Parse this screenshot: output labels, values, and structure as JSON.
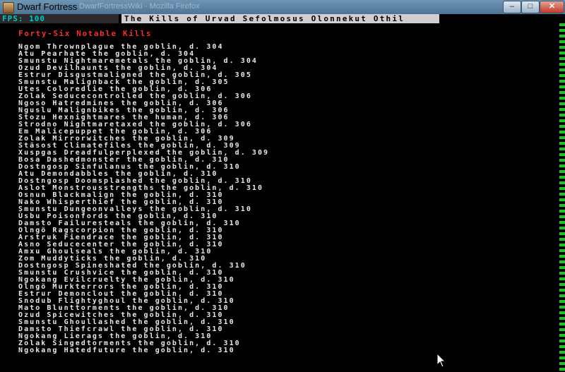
{
  "window": {
    "title": "Dwarf Fortress",
    "background_tab_title": "DwarfFortressWiki - Mozilla Firefox",
    "buttons": {
      "minimize": "–",
      "maximize": "□",
      "close": "✕"
    }
  },
  "header": {
    "fps_label": "FPS: 100",
    "title": "The Kills of Urvad Sefolmosus Olonnekut Othil"
  },
  "list": {
    "heading": "Forty-Six Notable Kills",
    "items": [
      "Ngom Thrownplague the goblin, d. 304",
      "Atu Pearhate the goblin, d. 304",
      "Smunstu Nightmaremetals the goblin, d. 304",
      "Ozud Devilhaunts the goblin, d. 304",
      "Estrur Disgustmaligned the goblin, d. 305",
      "Smunstu Malignback the goblin, d. 305",
      "Utes Coloredlie the goblin, d. 306",
      "Zolak Seducecontrolled the goblin, d. 306",
      "Ngoso Hatredmines the goblin, d. 306",
      "Nguslu Malignbikes the goblin, d. 306",
      "Stozu Hexnightmares the human, d. 306",
      "Strodno Nightmaretaxed the goblin, d. 306",
      "Em Malicepuppet the goblin, d. 306",
      "Zolak Mirrorwitches the goblin, d. 309",
      "Stäsost Climatefiles the goblin, d. 309",
      "Xuspgas Dreadfulperplexed the goblin, d. 309",
      "Bosa Dashedmonster the goblin, d. 310",
      "Dostngosp Sinfulanus the goblin, d. 310",
      "Atu Demondabbles the goblin, d. 310",
      "Dostngosp Doomsplashed the goblin, d. 310",
      "Aslot Monstrousstrengths the goblin, d. 310",
      "Osnun Blackmalign the goblin, d. 310",
      "Nako Whisperthief the goblin, d. 310",
      "Smunstu Dungeonvalleys the goblin, d. 310",
      "Ùsbu Poisonfords the goblin, d. 310",
      "Damsto Failuresteals the goblin, d. 310",
      "Olngö Ragscorpion the goblin, d. 310",
      "Arstruk Fiendrace the goblin, d. 310",
      "Asno Seducecenter the goblin, d. 310",
      "Amxu Ghoulseals the goblin, d. 310",
      "Zom Muddyticks the goblin, d. 310",
      "Dostngosp Spineshated the goblin, d. 310",
      "Smunstu Crushvice the goblin, d. 310",
      "Ngokang Evilcruelty the goblin, d. 310",
      "Olngö Murkterrors the goblin, d. 310",
      "Estrur Demonclout the goblin, d. 310",
      "Snodub Flightyghoul the goblin, d. 310",
      "Mato Blunttorments the goblin, d. 310",
      "Ozud Spicewitches the goblin, d. 310",
      "Smunstu Ghoullashed the goblin, d. 310",
      "Damsto Thiefcrawl the goblin, d. 310",
      "Ngokang Lierags the goblin, d. 310",
      "Zolak Singedtorments the goblin, d. 310",
      "Ngokang Hatedfuture the goblin, d. 310"
    ]
  },
  "colors": {
    "heading": "#ff2b2b",
    "text": "#e8e8e8",
    "fps": "#00c8c8",
    "title_bar_bg": "#cfcfcf",
    "border": "#1ec81e"
  }
}
